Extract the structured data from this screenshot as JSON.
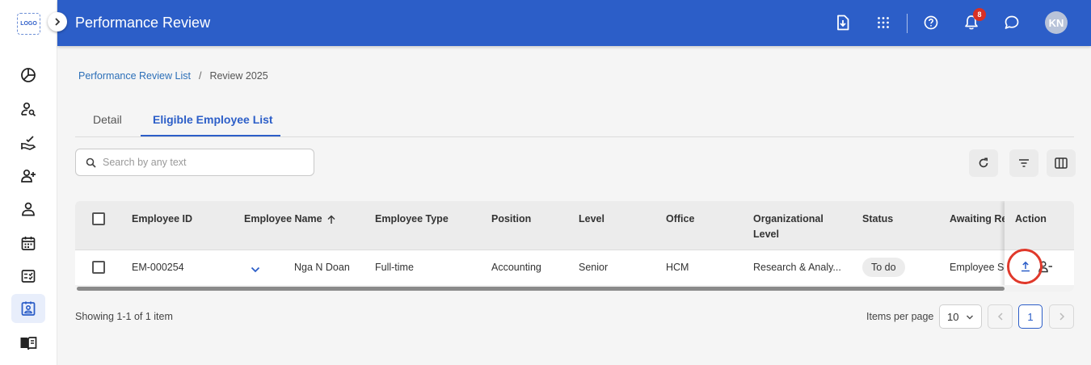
{
  "app": {
    "logo_text": "LOGO",
    "title": "Performance Review"
  },
  "header": {
    "notification_count": "8",
    "avatar_initials": "KN",
    "icons": [
      "download-icon",
      "apps-grid-icon",
      "help-icon",
      "bell-icon",
      "chat-icon"
    ]
  },
  "sidebar": {
    "items": [
      {
        "icon": "pie-chart-icon"
      },
      {
        "icon": "user-search-icon"
      },
      {
        "icon": "hand-check-icon"
      },
      {
        "icon": "user-add-icon"
      },
      {
        "icon": "user-icon"
      },
      {
        "icon": "calendar-icon"
      },
      {
        "icon": "checklist-icon"
      },
      {
        "icon": "contact-card-icon",
        "active": true
      },
      {
        "icon": "book-icon"
      }
    ]
  },
  "breadcrumb": {
    "parent": "Performance Review List",
    "separator": "/",
    "current": "Review 2025"
  },
  "tabs": [
    {
      "label": "Detail",
      "active": false
    },
    {
      "label": "Eligible Employee List",
      "active": true
    }
  ],
  "search": {
    "placeholder": "Search by any text",
    "value": ""
  },
  "table": {
    "columns": [
      "Employee ID",
      "Employee Name",
      "Employee Type",
      "Position",
      "Level",
      "Office",
      "Organizational Level",
      "Status",
      "Awaiting Re",
      "Action"
    ],
    "rows": [
      {
        "employee_id": "EM-000254",
        "employee_name": "Nga N Doan",
        "employee_type": "Full-time",
        "position": "Accounting",
        "level": "Senior",
        "office": "HCM",
        "organizational_level": "Research & Analy...",
        "status": "To do",
        "awaiting": "Employee S"
      }
    ]
  },
  "footer": {
    "showing": "Showing 1-1 of 1 item",
    "items_per_page_label": "Items per page",
    "items_per_page": "10",
    "current_page": "1"
  },
  "colors": {
    "primary": "#2c5ec8",
    "highlight": "#e0392b"
  }
}
